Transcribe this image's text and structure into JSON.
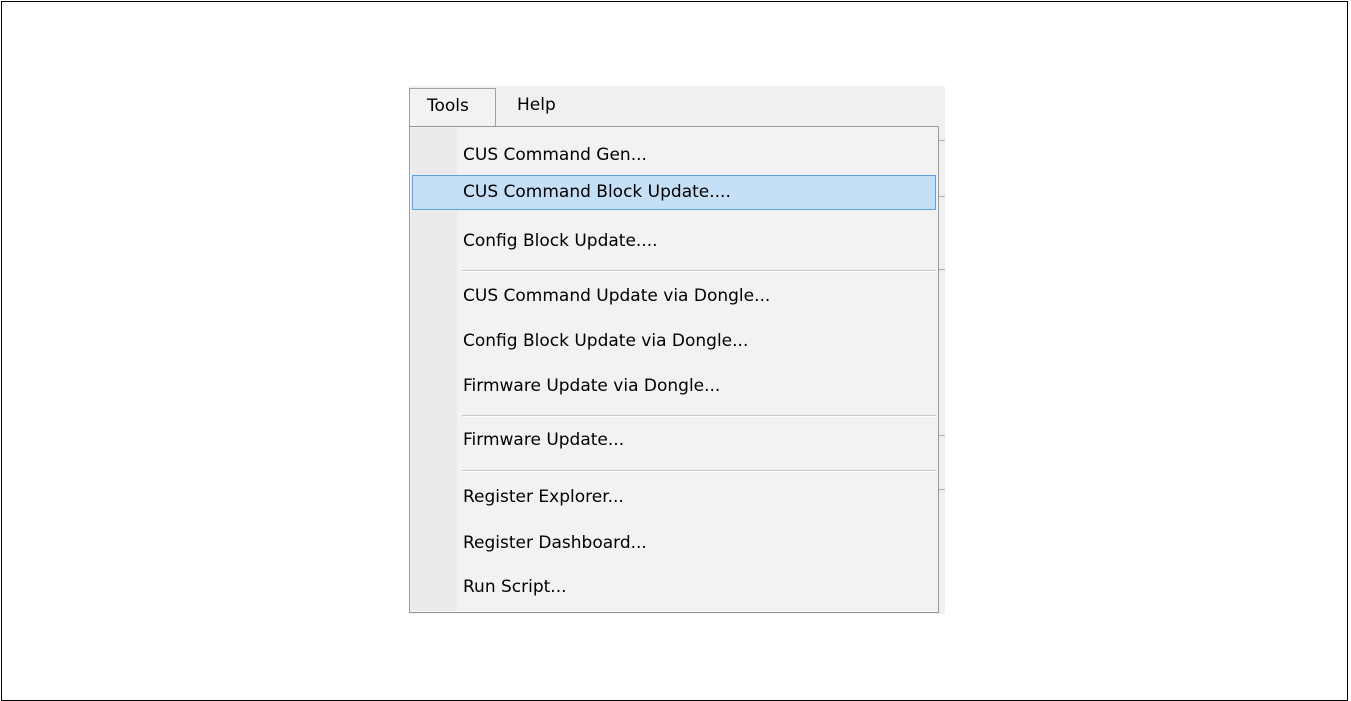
{
  "menubar": {
    "items": [
      {
        "label": "Tools",
        "open": true
      },
      {
        "label": "Help",
        "open": false
      }
    ]
  },
  "tools_menu": {
    "groups": [
      [
        {
          "label": "CUS Command Gen...",
          "highlighted": false
        },
        {
          "label": "CUS Command Block Update....",
          "highlighted": true
        },
        {
          "label": "Config Block Update....",
          "highlighted": false
        }
      ],
      [
        {
          "label": "CUS Command Update via Dongle...",
          "highlighted": false
        },
        {
          "label": "Config Block Update via Dongle...",
          "highlighted": false
        },
        {
          "label": "Firmware Update via Dongle...",
          "highlighted": false
        }
      ],
      [
        {
          "label": "Firmware Update...",
          "highlighted": false
        }
      ],
      [
        {
          "label": "Register Explorer...",
          "highlighted": false
        },
        {
          "label": "Register Dashboard...",
          "highlighted": false
        },
        {
          "label": "Run Script...",
          "highlighted": false
        }
      ]
    ]
  },
  "colors": {
    "highlight_fill": "#c5dff7",
    "highlight_border": "#5ba3e4",
    "menu_background": "#f2f2f2"
  }
}
